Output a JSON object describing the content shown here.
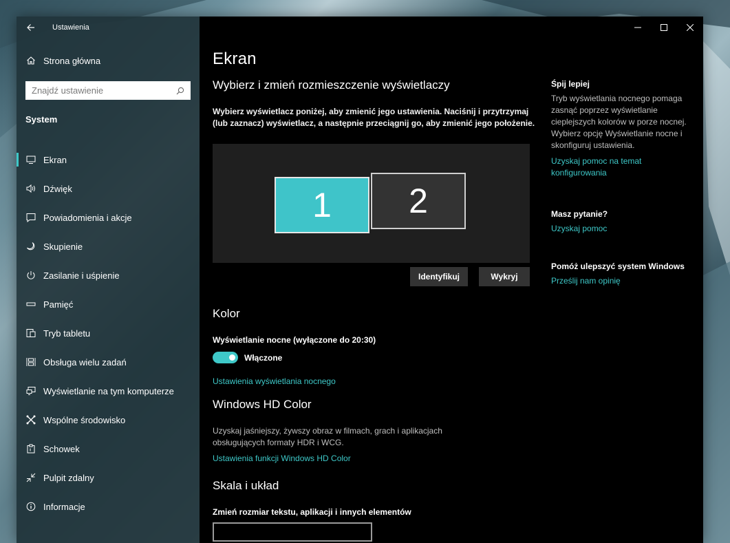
{
  "window": {
    "app_title": "Ustawienia"
  },
  "sidebar": {
    "home_label": "Strona główna",
    "search_placeholder": "Znajdź ustawienie",
    "section": "System",
    "items": [
      {
        "label": "Ekran",
        "icon": "monitor-icon"
      },
      {
        "label": "Dźwięk",
        "icon": "speaker-icon"
      },
      {
        "label": "Powiadomienia i akcje",
        "icon": "notification-icon"
      },
      {
        "label": "Skupienie",
        "icon": "moon-icon"
      },
      {
        "label": "Zasilanie i uśpienie",
        "icon": "power-icon"
      },
      {
        "label": "Pamięć",
        "icon": "storage-icon"
      },
      {
        "label": "Tryb tabletu",
        "icon": "tablet-icon"
      },
      {
        "label": "Obsługa wielu zadań",
        "icon": "multitasking-icon"
      },
      {
        "label": "Wyświetlanie na tym komputerze",
        "icon": "projecting-icon"
      },
      {
        "label": "Wspólne środowisko",
        "icon": "shared-experiences-icon"
      },
      {
        "label": "Schowek",
        "icon": "clipboard-icon"
      },
      {
        "label": "Pulpit zdalny",
        "icon": "remote-desktop-icon"
      },
      {
        "label": "Informacje",
        "icon": "info-icon"
      }
    ]
  },
  "main": {
    "page_title": "Ekran",
    "arrange_heading": "Wybierz i zmień rozmieszczenie wyświetlaczy",
    "arrange_desc": "Wybierz wyświetlacz poniżej, aby zmienić jego ustawienia. Naciśnij i przytrzymaj (lub zaznacz) wyświetlacz, a następnie przeciągnij go, aby zmienić jego położenie.",
    "monitors": [
      "1",
      "2"
    ],
    "identify_button": "Identyfikuj",
    "detect_button": "Wykryj",
    "color_heading": "Kolor",
    "night_light_label": "Wyświetlanie nocne (wyłączone do 20:30)",
    "night_light_toggle_label": "Włączone",
    "night_light_settings_link": "Ustawienia wyświetlania nocnego",
    "hdr_heading": "Windows HD Color",
    "hdr_desc": "Uzyskaj jaśniejszy, żywszy obraz w filmach, grach i aplikacjach obsługujących formaty HDR i WCG.",
    "hdr_link": "Ustawienia funkcji Windows HD Color",
    "scale_heading": "Skala i układ",
    "scale_label": "Zmień rozmiar tekstu, aplikacji i innych elementów"
  },
  "right": {
    "sleep_title": "Śpij lepiej",
    "sleep_text": "Tryb wyświetlania nocnego pomaga zasnąć poprzez wyświetlanie cieplejszych kolorów w porze nocnej. Wybierz opcję Wyświetlanie nocne i skonfiguruj ustawienia.",
    "sleep_link": "Uzyskaj pomoc na temat konfigurowania",
    "question_title": "Masz pytanie?",
    "question_link": "Uzyskaj pomoc",
    "improve_title": "Pomóż ulepszyć system Windows",
    "improve_link": "Prześlij nam opinię"
  },
  "colors": {
    "accent": "#3ec8c8",
    "sidebar_bg": "#20343a",
    "main_bg": "#000000",
    "monitor_selected": "#3fc4c9",
    "monitor_other": "#333333"
  }
}
